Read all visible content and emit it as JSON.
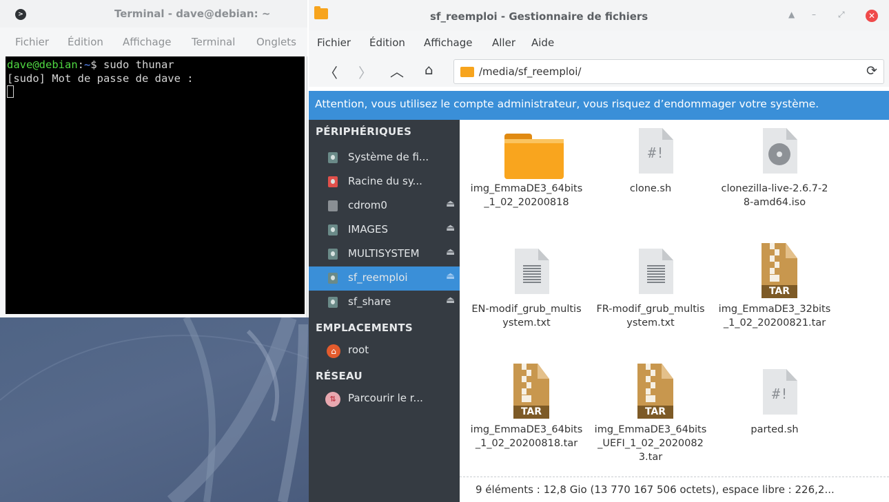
{
  "terminal": {
    "title": "Terminal - dave@debian: ~",
    "menu": [
      "Fichier",
      "Édition",
      "Affichage",
      "Terminal",
      "Onglets"
    ],
    "prompt_user": "dave@debian",
    "prompt_sep": ":",
    "prompt_path": "~",
    "prompt_symbol": "$ ",
    "command": "sudo thunar",
    "output_line": "[sudo] Mot de passe de dave :"
  },
  "file_manager": {
    "title": "sf_reemploi - Gestionnaire de fichiers",
    "menu": [
      "Fichier",
      "Édition",
      "Affichage",
      "Aller",
      "Aide"
    ],
    "location": "/media/sf_reemploi/",
    "warning": "Attention, vous utilisez le compte administrateur, vous risquez d’endommager votre système.",
    "sidebar": {
      "devices_heading": "PÉRIPHÉRIQUES",
      "devices": [
        {
          "label": "Système de fi...",
          "icon": "drive-icon",
          "eject": false
        },
        {
          "label": "Racine du sy...",
          "icon": "root-drive-icon",
          "eject": false
        },
        {
          "label": "cdrom0",
          "icon": "cdrom-icon",
          "eject": true
        },
        {
          "label": "IMAGES",
          "icon": "drive-icon",
          "eject": true
        },
        {
          "label": "MULTISYSTEM",
          "icon": "drive-icon",
          "eject": true
        },
        {
          "label": "sf_reemploi",
          "icon": "drive-icon",
          "eject": true,
          "selected": true
        },
        {
          "label": "sf_share",
          "icon": "drive-icon",
          "eject": true
        }
      ],
      "places_heading": "EMPLACEMENTS",
      "places": [
        {
          "label": "root",
          "icon": "home-icon"
        }
      ],
      "network_heading": "RÉSEAU",
      "network": [
        {
          "label": "Parcourir le r...",
          "icon": "network-icon"
        }
      ]
    },
    "files": [
      {
        "name": "img_EmmaDE3_64bits_1_02_20200818",
        "type": "folder"
      },
      {
        "name": "clone.sh",
        "type": "script"
      },
      {
        "name": "clonezilla-live-2.6.7-28-amd64.iso",
        "type": "iso"
      },
      {
        "name": "EN-modif_grub_multisystem.txt",
        "type": "text"
      },
      {
        "name": "FR-modif_grub_multisystem.txt",
        "type": "text"
      },
      {
        "name": "img_EmmaDE3_32bits_1_02_20200821.tar",
        "type": "tar"
      },
      {
        "name": "img_EmmaDE3_64bits_1_02_20200818.tar",
        "type": "tar"
      },
      {
        "name": "img_EmmaDE3_64bits_UEFI_1_02_20200823.tar",
        "type": "tar"
      },
      {
        "name": "parted.sh",
        "type": "script"
      }
    ],
    "tar_label": "TAR",
    "script_mark": "#!",
    "status": "9 éléments : 12,8 Gio (13 770 167 506 octets), espace libre : 226,2..."
  }
}
